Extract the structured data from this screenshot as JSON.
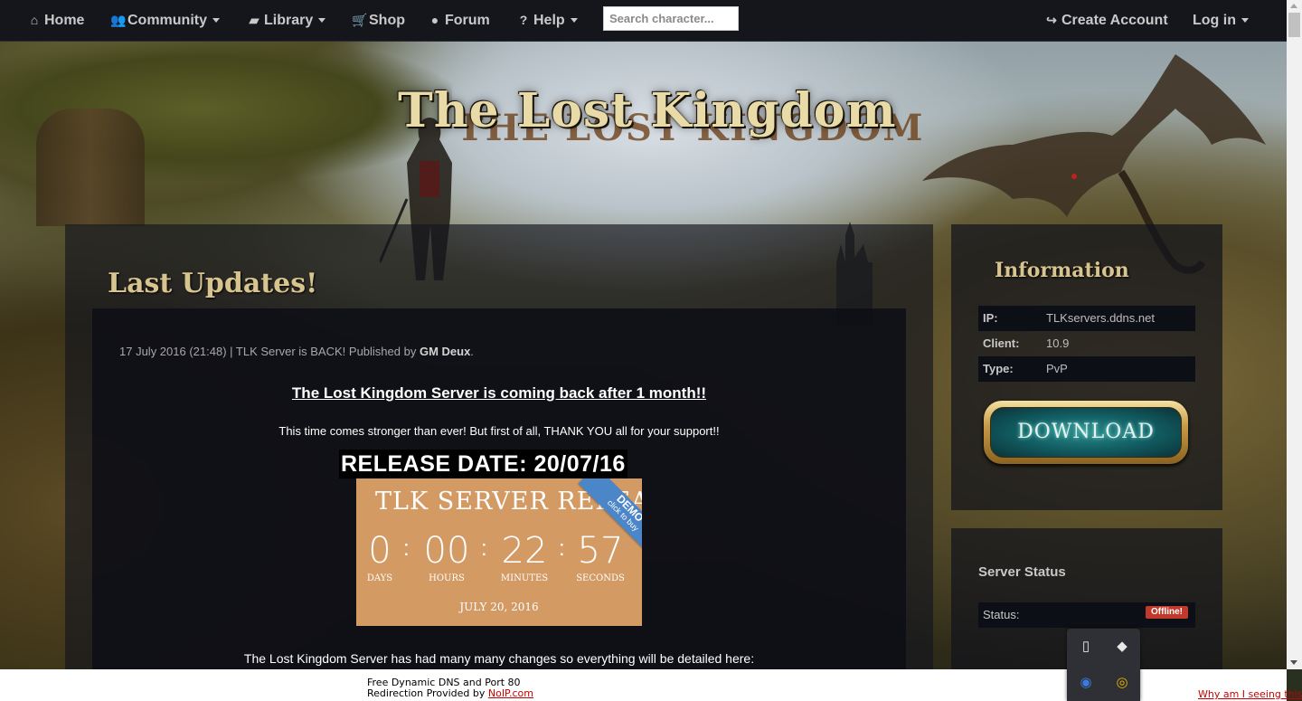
{
  "nav": {
    "home": "Home",
    "community": "Community",
    "library": "Library",
    "shop": "Shop",
    "forum": "Forum",
    "help": "Help",
    "search_placeholder": "Search character...",
    "create_account": "Create Account",
    "login": "Log in"
  },
  "logo": {
    "text": "The Lost Kingdom",
    "shadow_text": "THE LOST KINGDOM"
  },
  "main": {
    "title": "Last Updates!",
    "news": {
      "date": "17 July 2016 (21:48)",
      "separator": " | ",
      "headline_short": "TLK Server is BACK!",
      "published_by": " Published by ",
      "author": "GM Deux",
      "period": ".",
      "headline": "The Lost Kingdom Server is coming back after 1 month!!",
      "thanks": "This time comes stronger than ever! But first of all, THANK YOU all for your support!!",
      "release_date": "RELEASE DATE: 20/07/16",
      "countdown": {
        "title": "TLK SERVER RELEA",
        "days": "0",
        "hours": "00",
        "minutes": "22",
        "seconds": "57",
        "days_label": "DAYS",
        "hours_label": "HOURS",
        "minutes_label": "MINUTES",
        "seconds_label": "SECONDS",
        "footer": "JULY 20, 2016",
        "ribbon_main": "DEMO",
        "ribbon_sub": "click to buy"
      },
      "changes_intro": "The Lost Kingdom Server has had many many changes so everything will be detailed here:"
    }
  },
  "sidebar": {
    "info_title": "Information",
    "info_rows": [
      {
        "key": "IP:",
        "value": "TLKservers.ddns.net"
      },
      {
        "key": "Client:",
        "value": "10.9"
      },
      {
        "key": "Type:",
        "value": "PvP"
      }
    ],
    "download_label": "DOWNLOAD",
    "status_title": "Server Status",
    "status_label": "Status:",
    "status_value": "Offline!"
  },
  "banner": {
    "line1": "Free Dynamic DNS and Port 80",
    "line2_prefix": "Redirection Provided by ",
    "line2_link": "NoIP.com",
    "why": "Why am I seeing this?"
  },
  "colors": {
    "nav_bg": "#15161c",
    "title_gold": "#d8c48e",
    "status_offline": "#c0392b",
    "countdown_bg": "#d39a64",
    "ribbon": "#4a86c8"
  },
  "icons": {
    "home": "home-icon",
    "community": "users-icon",
    "library": "book-icon",
    "shop": "cart-icon",
    "forum": "chat-icon",
    "help": "question-icon",
    "create_account": "share-arrow-icon"
  }
}
